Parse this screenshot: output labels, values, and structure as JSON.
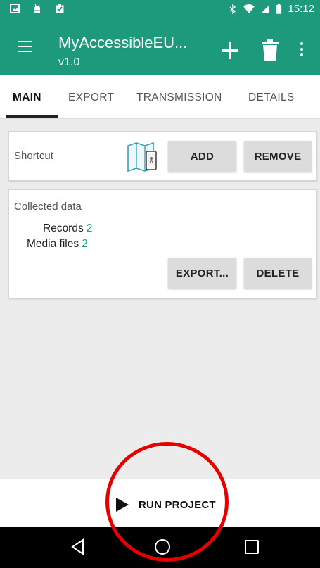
{
  "status_bar": {
    "time": "15:12"
  },
  "app_bar": {
    "title": "MyAccessibleEU...",
    "subtitle": "v1.0"
  },
  "tabs": [
    {
      "label": "MAIN",
      "active": true
    },
    {
      "label": "EXPORT",
      "active": false
    },
    {
      "label": "TRANSMISSION",
      "active": false
    },
    {
      "label": "DETAILS",
      "active": false
    }
  ],
  "shortcut_card": {
    "label": "Shortcut",
    "add_label": "ADD",
    "remove_label": "REMOVE"
  },
  "collected_card": {
    "title": "Collected data",
    "records_label": "Records",
    "records_value": "2",
    "media_label": "Media files",
    "media_value": "2",
    "export_label": "EXPORT...",
    "delete_label": "DELETE"
  },
  "run_button": {
    "label": "RUN PROJECT"
  },
  "colors": {
    "primary": "#1c9a7b",
    "accent_value": "#14a38a",
    "annotation": "#e60000"
  },
  "icons": [
    "gallery-icon",
    "android-icon",
    "clipboard-check-icon",
    "bluetooth-icon",
    "wifi-icon",
    "signal-icon",
    "battery-icon",
    "menu-icon",
    "add-icon",
    "trash-icon",
    "more-vert-icon",
    "map-phone-icon",
    "play-icon",
    "back-icon",
    "home-icon",
    "recents-icon"
  ]
}
